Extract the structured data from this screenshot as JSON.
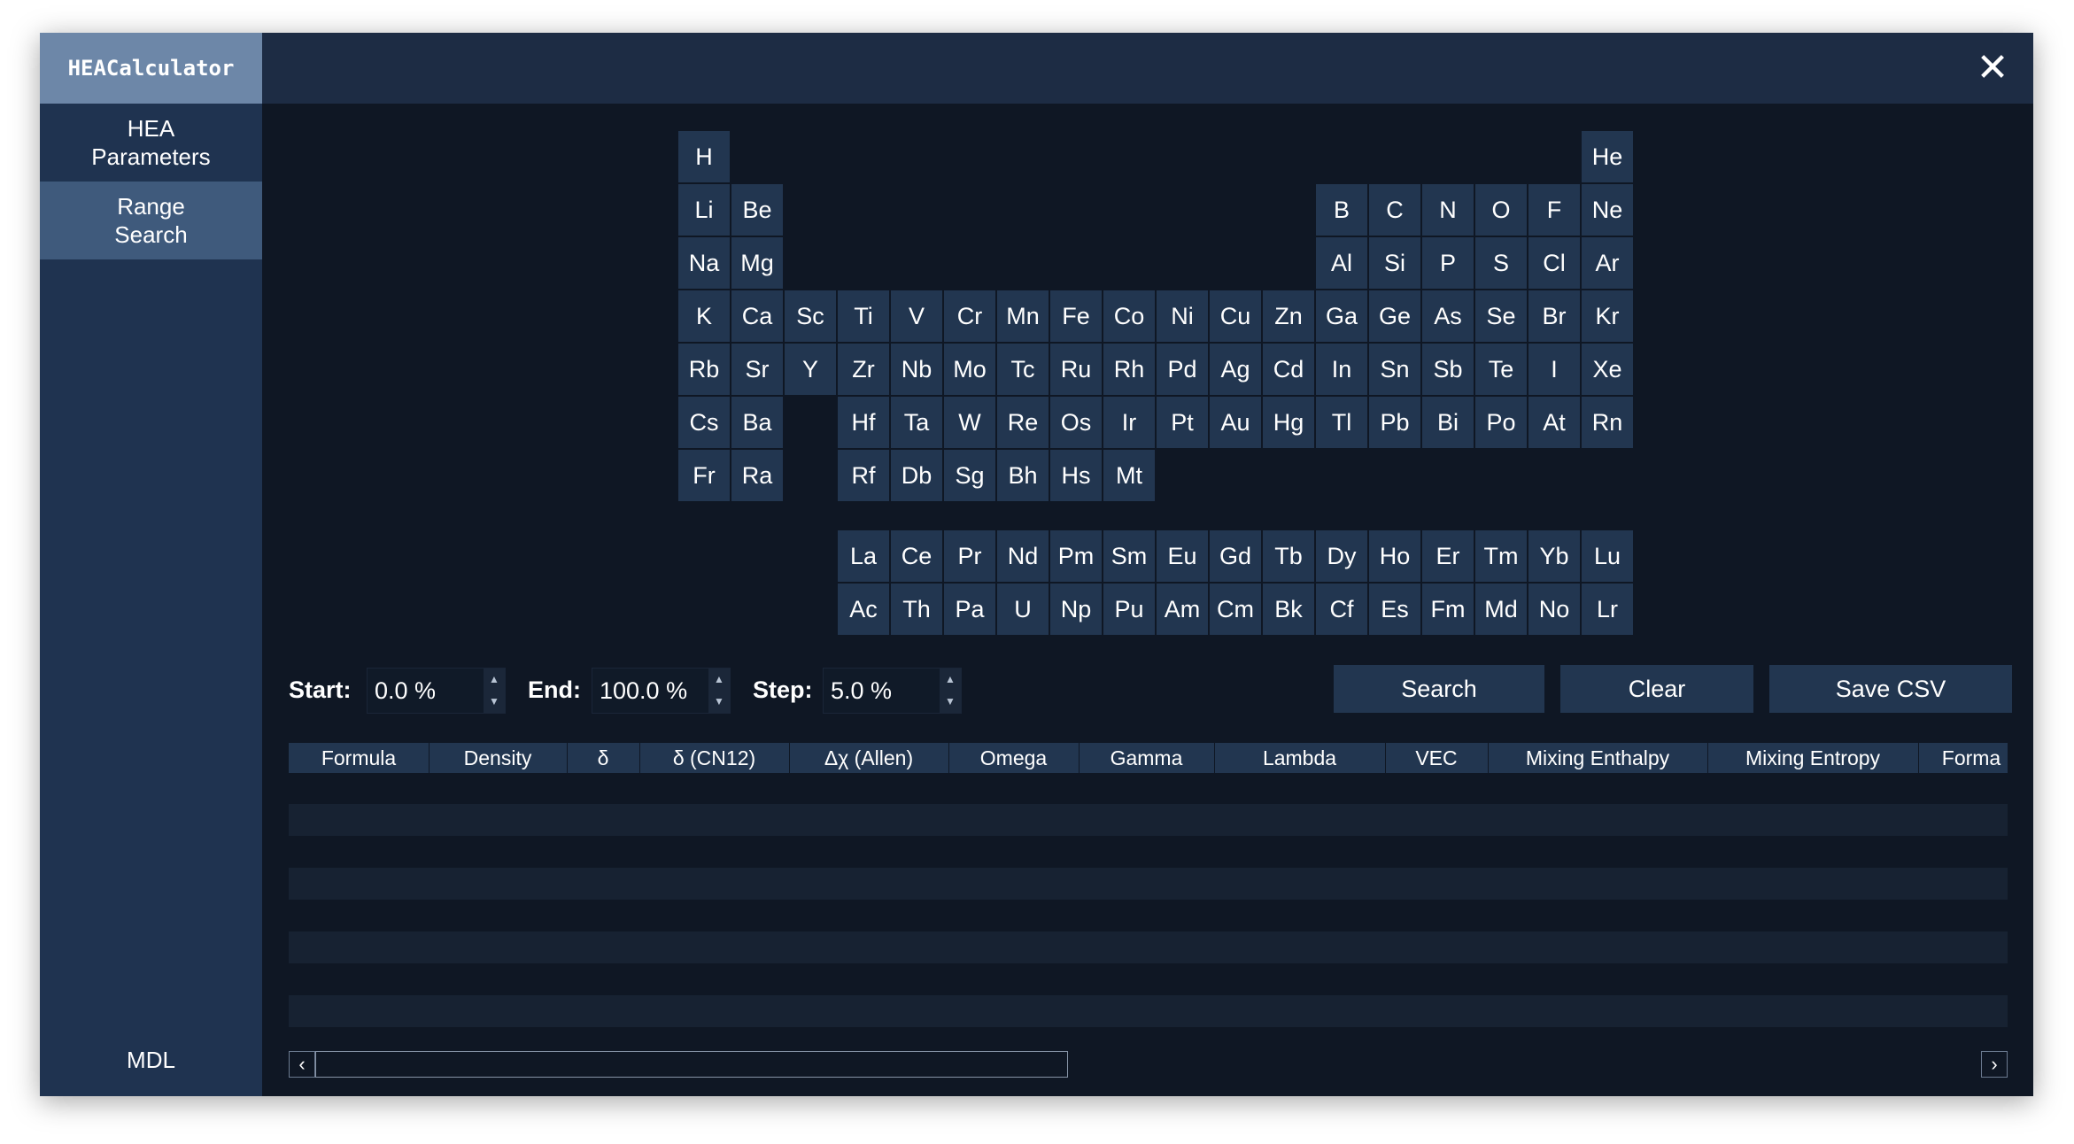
{
  "app": {
    "title": "HEACalculator",
    "close": "✕",
    "footer": "MDL"
  },
  "sidebar": {
    "items": [
      "HEA Parameters",
      "Range Search"
    ],
    "active": 1
  },
  "periodic_table": {
    "elements": [
      [
        "H",
        1,
        1
      ],
      [
        "He",
        1,
        18
      ],
      [
        "Li",
        2,
        1
      ],
      [
        "Be",
        2,
        2
      ],
      [
        "B",
        2,
        13
      ],
      [
        "C",
        2,
        14
      ],
      [
        "N",
        2,
        15
      ],
      [
        "O",
        2,
        16
      ],
      [
        "F",
        2,
        17
      ],
      [
        "Ne",
        2,
        18
      ],
      [
        "Na",
        3,
        1
      ],
      [
        "Mg",
        3,
        2
      ],
      [
        "Al",
        3,
        13
      ],
      [
        "Si",
        3,
        14
      ],
      [
        "P",
        3,
        15
      ],
      [
        "S",
        3,
        16
      ],
      [
        "Cl",
        3,
        17
      ],
      [
        "Ar",
        3,
        18
      ],
      [
        "K",
        4,
        1
      ],
      [
        "Ca",
        4,
        2
      ],
      [
        "Sc",
        4,
        3
      ],
      [
        "Ti",
        4,
        4
      ],
      [
        "V",
        4,
        5
      ],
      [
        "Cr",
        4,
        6
      ],
      [
        "Mn",
        4,
        7
      ],
      [
        "Fe",
        4,
        8
      ],
      [
        "Co",
        4,
        9
      ],
      [
        "Ni",
        4,
        10
      ],
      [
        "Cu",
        4,
        11
      ],
      [
        "Zn",
        4,
        12
      ],
      [
        "Ga",
        4,
        13
      ],
      [
        "Ge",
        4,
        14
      ],
      [
        "As",
        4,
        15
      ],
      [
        "Se",
        4,
        16
      ],
      [
        "Br",
        4,
        17
      ],
      [
        "Kr",
        4,
        18
      ],
      [
        "Rb",
        5,
        1
      ],
      [
        "Sr",
        5,
        2
      ],
      [
        "Y",
        5,
        3
      ],
      [
        "Zr",
        5,
        4
      ],
      [
        "Nb",
        5,
        5
      ],
      [
        "Mo",
        5,
        6
      ],
      [
        "Tc",
        5,
        7
      ],
      [
        "Ru",
        5,
        8
      ],
      [
        "Rh",
        5,
        9
      ],
      [
        "Pd",
        5,
        10
      ],
      [
        "Ag",
        5,
        11
      ],
      [
        "Cd",
        5,
        12
      ],
      [
        "In",
        5,
        13
      ],
      [
        "Sn",
        5,
        14
      ],
      [
        "Sb",
        5,
        15
      ],
      [
        "Te",
        5,
        16
      ],
      [
        "I",
        5,
        17
      ],
      [
        "Xe",
        5,
        18
      ],
      [
        "Cs",
        6,
        1
      ],
      [
        "Ba",
        6,
        2
      ],
      [
        "Hf",
        6,
        4
      ],
      [
        "Ta",
        6,
        5
      ],
      [
        "W",
        6,
        6
      ],
      [
        "Re",
        6,
        7
      ],
      [
        "Os",
        6,
        8
      ],
      [
        "Ir",
        6,
        9
      ],
      [
        "Pt",
        6,
        10
      ],
      [
        "Au",
        6,
        11
      ],
      [
        "Hg",
        6,
        12
      ],
      [
        "Tl",
        6,
        13
      ],
      [
        "Pb",
        6,
        14
      ],
      [
        "Bi",
        6,
        15
      ],
      [
        "Po",
        6,
        16
      ],
      [
        "At",
        6,
        17
      ],
      [
        "Rn",
        6,
        18
      ],
      [
        "Fr",
        7,
        1
      ],
      [
        "Ra",
        7,
        2
      ],
      [
        "Rf",
        7,
        4
      ],
      [
        "Db",
        7,
        5
      ],
      [
        "Sg",
        7,
        6
      ],
      [
        "Bh",
        7,
        7
      ],
      [
        "Hs",
        7,
        8
      ],
      [
        "Mt",
        7,
        9
      ],
      [
        "La",
        8,
        4
      ],
      [
        "Ce",
        8,
        5
      ],
      [
        "Pr",
        8,
        6
      ],
      [
        "Nd",
        8,
        7
      ],
      [
        "Pm",
        8,
        8
      ],
      [
        "Sm",
        8,
        9
      ],
      [
        "Eu",
        8,
        10
      ],
      [
        "Gd",
        8,
        11
      ],
      [
        "Tb",
        8,
        12
      ],
      [
        "Dy",
        8,
        13
      ],
      [
        "Ho",
        8,
        14
      ],
      [
        "Er",
        8,
        15
      ],
      [
        "Tm",
        8,
        16
      ],
      [
        "Yb",
        8,
        17
      ],
      [
        "Lu",
        8,
        18
      ],
      [
        "Ac",
        9,
        4
      ],
      [
        "Th",
        9,
        5
      ],
      [
        "Pa",
        9,
        6
      ],
      [
        "U",
        9,
        7
      ],
      [
        "Np",
        9,
        8
      ],
      [
        "Pu",
        9,
        9
      ],
      [
        "Am",
        9,
        10
      ],
      [
        "Cm",
        9,
        11
      ],
      [
        "Bk",
        9,
        12
      ],
      [
        "Cf",
        9,
        13
      ],
      [
        "Es",
        9,
        14
      ],
      [
        "Fm",
        9,
        15
      ],
      [
        "Md",
        9,
        16
      ],
      [
        "No",
        9,
        17
      ],
      [
        "Lr",
        9,
        18
      ]
    ]
  },
  "controls": {
    "start_label": "Start:",
    "start_value": "0.0 %",
    "end_label": "End:",
    "end_value": "100.0 %",
    "step_label": "Step:",
    "step_value": "5.0 %",
    "up_arrow": "▲",
    "down_arrow": "▼"
  },
  "buttons": {
    "search": "Search",
    "clear": "Clear",
    "save_csv": "Save CSV"
  },
  "table": {
    "columns": [
      "Formula",
      "Density",
      "δ",
      "δ (CN12)",
      "Δχ (Allen)",
      "Omega",
      "Gamma",
      "Lambda",
      "VEC",
      "Mixing Enthalpy",
      "Mixing Entropy",
      "Forma"
    ],
    "rows": []
  },
  "scrollbar": {
    "left": "‹",
    "right": "›"
  },
  "colors": {
    "sidebar": "#1f3350",
    "title_bg": "#6d87a8",
    "active_nav": "#3f5a7c",
    "cell": "#223650",
    "window_bg": "#0f1724"
  }
}
